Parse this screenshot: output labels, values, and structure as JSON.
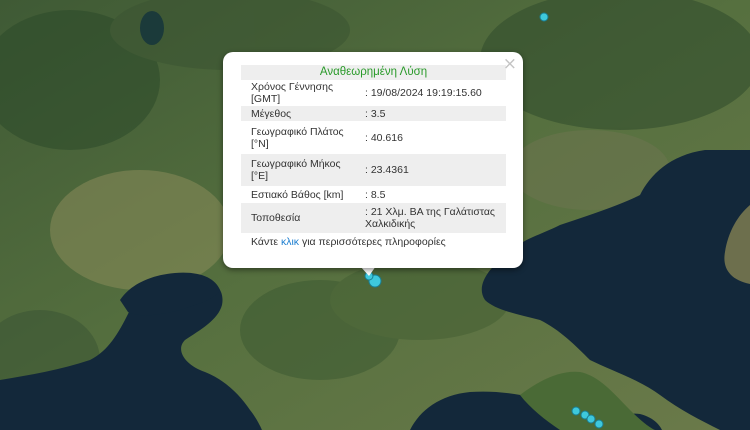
{
  "popup": {
    "title": "Αναθεωρημένη Λύση",
    "close_symbol": "×",
    "rows": [
      {
        "label": "Χρόνος Γέννησης [GMT]",
        "value": ": 19/08/2024 19:19:15.60"
      },
      {
        "label": "Μέγεθος",
        "value": ": 3.5"
      },
      {
        "label": "Γεωγραφικό Πλάτος [°N]",
        "value": ": 40.616"
      },
      {
        "label": "Γεωγραφικό Μήκος [°E]",
        "value": ": 23.4361"
      },
      {
        "label": "Εστιακό Βάθος [km]",
        "value": ": 8.5"
      },
      {
        "label": "Τοποθεσία",
        "value": ": 21 Χλμ. ΒΑ της Γαλάτιστας Χαλκιδικής"
      }
    ],
    "more_prefix": "Κάντε ",
    "more_link": "κλικ",
    "more_suffix": " για περισσότερες πληροφορίες"
  },
  "marker_color": "#3ec8dc",
  "water_color": "#13283a",
  "land_color": "#4e6a3c"
}
